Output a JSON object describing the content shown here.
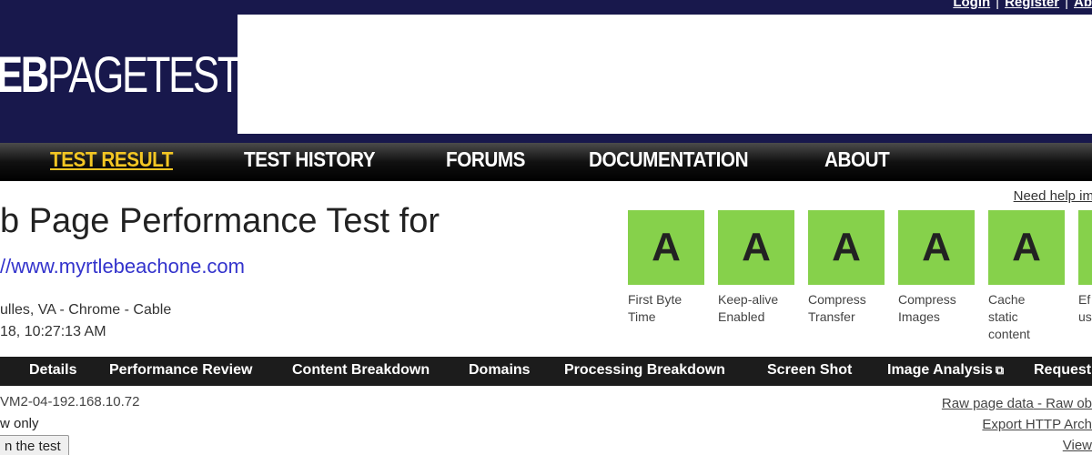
{
  "header": {
    "logo_bold": "EB",
    "logo_rest": "PAGETEST",
    "top_links": [
      "Login",
      "Register",
      "Ab"
    ]
  },
  "nav": {
    "items": [
      "TEST RESULT",
      "TEST HISTORY",
      "FORUMS",
      "DOCUMENTATION",
      "ABOUT"
    ],
    "active": "TEST RESULT"
  },
  "test": {
    "title": "b Page Performance Test for",
    "url": "//www.myrtlebeachone.com",
    "location": "ulles, VA - Chrome - Cable",
    "datetime": "18, 10:27:13 AM",
    "need_help": "Need help im"
  },
  "grades": [
    {
      "grade": "A",
      "label": "First Byte Time"
    },
    {
      "grade": "A",
      "label": "Keep-alive Enabled"
    },
    {
      "grade": "A",
      "label": "Compress Transfer"
    },
    {
      "grade": "A",
      "label": "Compress Images"
    },
    {
      "grade": "A",
      "label": "Cache static content"
    },
    {
      "grade": "",
      "label": "Ef us"
    }
  ],
  "result_nav": {
    "items": [
      "Details",
      "Performance Review",
      "Content Breakdown",
      "Domains",
      "Processing Breakdown",
      "Screen Shot",
      "Image Analysis",
      "Request"
    ]
  },
  "bottom": {
    "host": "VM2-04-192.168.10.72",
    "view_only": "w only",
    "rerun_button": "n the test",
    "raw_page_data": "Raw page data",
    "raw_obj": "Raw ob",
    "export_har": "Export HTTP Arch",
    "view": "View"
  },
  "colors": {
    "header_bg": "#18184c",
    "grade_green": "#86d14b",
    "nav_active": "#f3c623",
    "link_blue": "#3333cc"
  }
}
